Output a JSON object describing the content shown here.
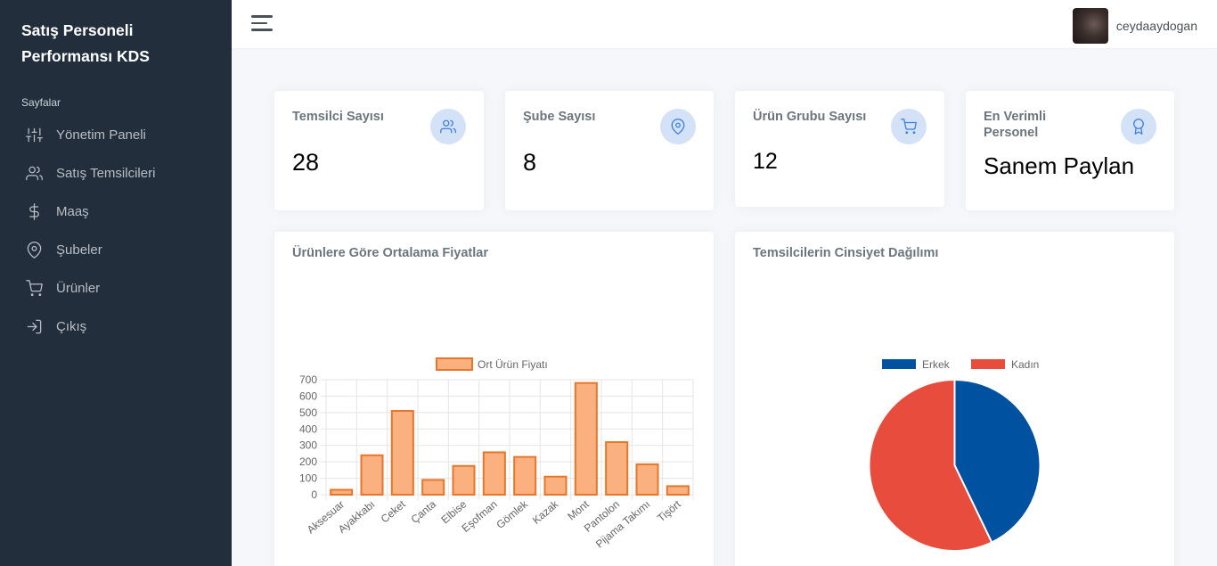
{
  "sidebar": {
    "brand": "Satış Personeli Performansı KDS",
    "header": "Sayfalar",
    "items": [
      {
        "label": "Yönetim Paneli",
        "icon": "sliders-icon"
      },
      {
        "label": "Satış Temsilcileri",
        "icon": "users-icon"
      },
      {
        "label": "Maaş",
        "icon": "dollar-icon"
      },
      {
        "label": "Şubeler",
        "icon": "map-pin-icon"
      },
      {
        "label": "Ürünler",
        "icon": "shopping-cart-icon"
      },
      {
        "label": "Çıkış",
        "icon": "log-in-icon"
      }
    ]
  },
  "topbar": {
    "username": "ceydaaydogan"
  },
  "stats": [
    {
      "title": "Temsilci Sayısı",
      "value": "28",
      "icon": "users-icon"
    },
    {
      "title": "Şube Sayısı",
      "value": "8",
      "icon": "map-pin-icon"
    },
    {
      "title": "Ürün Grubu Sayısı",
      "value": "12",
      "icon": "shopping-cart-icon"
    },
    {
      "title": "En Verimli Personel",
      "value": "Sanem Paylan",
      "icon": "award-icon"
    }
  ],
  "colors": {
    "sidebar": "#222e3c",
    "accent": "#3b7ddd",
    "bar_fill": "#fbb17f",
    "bar_border": "#e8762a",
    "male": "#00519f",
    "female": "#e74c3c"
  },
  "chart_data": [
    {
      "type": "bar",
      "title": "Ürünlere Göre Ortalama Fiyatlar",
      "categories": [
        "Aksesuar",
        "Ayakkabı",
        "Ceket",
        "Çanta",
        "Elbise",
        "Eşofman",
        "Gömlek",
        "Kazak",
        "Mont",
        "Pantolon",
        "Pijama Takımı",
        "Tişört"
      ],
      "series": [
        {
          "name": "Ort Ürün Fiyatı",
          "values": [
            30,
            240,
            510,
            90,
            175,
            258,
            230,
            110,
            680,
            320,
            185,
            52
          ]
        }
      ],
      "ylim": [
        0,
        700
      ],
      "yticks": [
        0,
        100,
        200,
        300,
        400,
        500,
        600,
        700
      ],
      "grid": true,
      "legend": "top"
    },
    {
      "type": "pie",
      "title": "Temsilcilerin Cinsiyet Dağılımı",
      "labels": [
        "Erkek",
        "Kadın"
      ],
      "values": [
        12,
        16
      ],
      "legend": "top"
    }
  ]
}
